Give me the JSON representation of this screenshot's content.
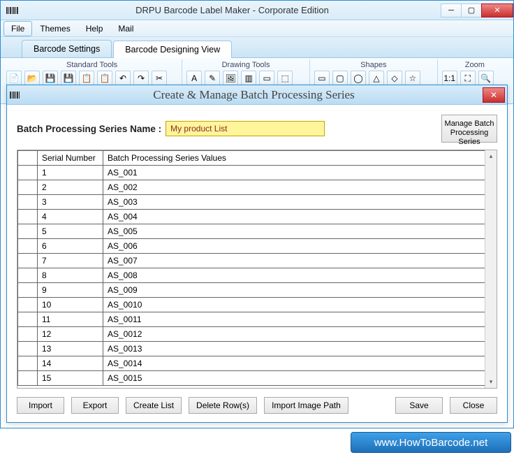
{
  "window": {
    "title": "DRPU Barcode Label Maker - Corporate Edition"
  },
  "menu": {
    "file": "File",
    "themes": "Themes",
    "help": "Help",
    "mail": "Mail"
  },
  "tabs": {
    "settings": "Barcode Settings",
    "designing": "Barcode Designing View"
  },
  "ribbon": {
    "standard": "Standard Tools",
    "drawing": "Drawing Tools",
    "shapes": "Shapes",
    "zoom": "Zoom"
  },
  "modal": {
    "title": "Create & Manage Batch Processing Series",
    "name_label": "Batch Processing Series Name :",
    "name_value": "My product List",
    "manage_btn": "Manage  Batch Processing Series",
    "headers": {
      "sn": "Serial Number",
      "val": "Batch Processing Series Values"
    },
    "rows": [
      {
        "sn": "1",
        "val": "AS_001"
      },
      {
        "sn": "2",
        "val": "AS_002"
      },
      {
        "sn": "3",
        "val": "AS_003"
      },
      {
        "sn": "4",
        "val": "AS_004"
      },
      {
        "sn": "5",
        "val": "AS_005"
      },
      {
        "sn": "6",
        "val": "AS_006"
      },
      {
        "sn": "7",
        "val": "AS_007"
      },
      {
        "sn": "8",
        "val": "AS_008"
      },
      {
        "sn": "9",
        "val": "AS_009"
      },
      {
        "sn": "10",
        "val": "AS_0010"
      },
      {
        "sn": "11",
        "val": "AS_0011"
      },
      {
        "sn": "12",
        "val": "AS_0012"
      },
      {
        "sn": "13",
        "val": "AS_0013"
      },
      {
        "sn": "14",
        "val": "AS_0014"
      },
      {
        "sn": "15",
        "val": "AS_0015"
      }
    ],
    "buttons": {
      "import": "Import",
      "export": "Export",
      "create": "Create List",
      "delete": "Delete Row(s)",
      "importimg": "Import Image Path",
      "save": "Save",
      "close": "Close"
    }
  },
  "watermark": "www.HowToBarcode.net"
}
